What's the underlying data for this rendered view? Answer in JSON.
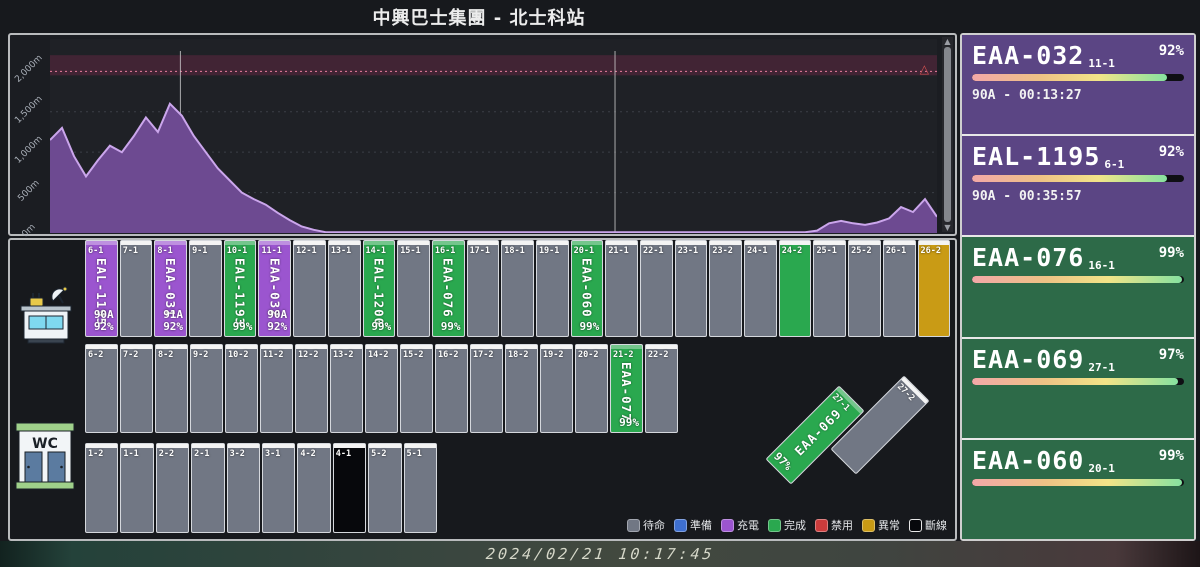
{
  "title": "中興巴士集團 - 北士科站",
  "timestamp": "2024/02/21 10:17:45",
  "chart_data": {
    "type": "area",
    "title": "",
    "xlabel": "",
    "ylabel": "distance (m)",
    "ytick_labels": [
      "2,000m",
      "1,500m",
      "1,000m",
      "500m",
      "0m"
    ],
    "yticks": [
      2000,
      1500,
      1000,
      500,
      0
    ],
    "ylim": [
      0,
      2400
    ],
    "grid": "dashed horizontal",
    "threshold_value": 2000,
    "threshold_band": [
      1950,
      2200
    ],
    "vertical_marker_fractions": [
      0.147,
      0.637
    ],
    "area_color": "#6d4a91",
    "line_color": "#cba6ec",
    "band_color": "#412434",
    "threshold_color": "#e87d9d",
    "series": [
      {
        "name": "distance",
        "values": [
          1150,
          1300,
          950,
          700,
          900,
          1080,
          1000,
          1200,
          1430,
          1250,
          1600,
          1450,
          1200,
          1000,
          800,
          650,
          500,
          420,
          350,
          250,
          160,
          80,
          40,
          10,
          10,
          10,
          10,
          10,
          10,
          10,
          10,
          10,
          10,
          10,
          10,
          10,
          10,
          10,
          10,
          10,
          10,
          10,
          10,
          10,
          10,
          10,
          10,
          10,
          10,
          10,
          10,
          10,
          10,
          10,
          10,
          10,
          10,
          10,
          10,
          10,
          10,
          10,
          10,
          10,
          30,
          120,
          150,
          120,
          100,
          130,
          180,
          320,
          260,
          420,
          200
        ]
      }
    ]
  },
  "status_colors": {
    "idle": "#717784",
    "ready": "#3e6fd0",
    "charging": "#9b55cf",
    "done": "#2aa84f",
    "disabled": "#cc3c3c",
    "abnormal": "#c99b15",
    "offline": "#07080c"
  },
  "card_colors": {
    "charging": "#5b4584",
    "done": "#2d6a48"
  },
  "legend": [
    {
      "label": "待命",
      "status": "idle"
    },
    {
      "label": "準備",
      "status": "ready"
    },
    {
      "label": "充電",
      "status": "charging"
    },
    {
      "label": "完成",
      "status": "done"
    },
    {
      "label": "禁用",
      "status": "disabled"
    },
    {
      "label": "異常",
      "status": "abnormal"
    },
    {
      "label": "斷線",
      "status": "offline"
    }
  ],
  "parking": {
    "row1": [
      {
        "id": "6-1",
        "status": "charging",
        "vehicle": "EAL-1195",
        "amp": "90A",
        "pct": "92%"
      },
      {
        "id": "7-1",
        "status": "idle"
      },
      {
        "id": "8-1",
        "status": "charging",
        "vehicle": "EAA-031",
        "amp": "91A",
        "pct": "92%"
      },
      {
        "id": "9-1",
        "status": "idle"
      },
      {
        "id": "10-1",
        "status": "done",
        "vehicle": "EAL-1193",
        "pct": "99%"
      },
      {
        "id": "11-1",
        "status": "charging",
        "vehicle": "EAA-032",
        "amp": "90A",
        "pct": "92%"
      },
      {
        "id": "12-1",
        "status": "idle"
      },
      {
        "id": "13-1",
        "status": "idle"
      },
      {
        "id": "14-1",
        "status": "done",
        "vehicle": "EAL-1200",
        "pct": "99%"
      },
      {
        "id": "15-1",
        "status": "idle"
      },
      {
        "id": "16-1",
        "status": "done",
        "vehicle": "EAA-076",
        "pct": "99%"
      },
      {
        "id": "17-1",
        "status": "idle"
      },
      {
        "id": "18-1",
        "status": "idle"
      },
      {
        "id": "19-1",
        "status": "idle"
      },
      {
        "id": "20-1",
        "status": "done",
        "vehicle": "EAA-060",
        "pct": "99%"
      },
      {
        "id": "21-1",
        "status": "idle"
      },
      {
        "id": "22-1",
        "status": "idle"
      },
      {
        "id": "23-1",
        "status": "idle"
      },
      {
        "id": "23-2",
        "status": "idle"
      },
      {
        "id": "24-1",
        "status": "idle"
      },
      {
        "id": "24-2",
        "status": "done"
      },
      {
        "id": "25-1",
        "status": "idle"
      },
      {
        "id": "25-2",
        "status": "idle"
      },
      {
        "id": "26-1",
        "status": "idle"
      },
      {
        "id": "26-2",
        "status": "abnormal"
      }
    ],
    "row2": [
      {
        "id": "6-2",
        "status": "idle"
      },
      {
        "id": "7-2",
        "status": "idle"
      },
      {
        "id": "8-2",
        "status": "idle"
      },
      {
        "id": "9-2",
        "status": "idle"
      },
      {
        "id": "10-2",
        "status": "idle"
      },
      {
        "id": "11-2",
        "status": "idle"
      },
      {
        "id": "12-2",
        "status": "idle"
      },
      {
        "id": "13-2",
        "status": "idle"
      },
      {
        "id": "14-2",
        "status": "idle"
      },
      {
        "id": "15-2",
        "status": "idle"
      },
      {
        "id": "16-2",
        "status": "idle"
      },
      {
        "id": "17-2",
        "status": "idle"
      },
      {
        "id": "18-2",
        "status": "idle"
      },
      {
        "id": "19-2",
        "status": "idle"
      },
      {
        "id": "20-2",
        "status": "idle"
      },
      {
        "id": "21-2",
        "status": "done",
        "vehicle": "EAA-077",
        "pct": "99%"
      },
      {
        "id": "22-2",
        "status": "idle"
      }
    ],
    "row3": [
      {
        "id": "1-2",
        "status": "idle"
      },
      {
        "id": "1-1",
        "status": "idle"
      },
      {
        "id": "2-2",
        "status": "idle"
      },
      {
        "id": "2-1",
        "status": "idle"
      },
      {
        "id": "3-2",
        "status": "idle"
      },
      {
        "id": "3-1",
        "status": "idle"
      },
      {
        "id": "4-2",
        "status": "idle"
      },
      {
        "id": "4-1",
        "status": "offline"
      },
      {
        "id": "5-2",
        "status": "idle"
      },
      {
        "id": "5-1",
        "status": "idle"
      }
    ],
    "diagonal": [
      {
        "id": "27-1",
        "status": "done",
        "vehicle": "EAA-069",
        "pct": "97%"
      },
      {
        "id": "27-2",
        "status": "idle"
      }
    ]
  },
  "cards": [
    {
      "vehicle": "EAA-032",
      "slot": "11-1",
      "pct": 92,
      "pct_label": "92%",
      "detail": "90A - 00:13:27",
      "status": "charging"
    },
    {
      "vehicle": "EAL-1195",
      "slot": "6-1",
      "pct": 92,
      "pct_label": "92%",
      "detail": "90A - 00:35:57",
      "status": "charging"
    },
    {
      "vehicle": "EAA-076",
      "slot": "16-1",
      "pct": 99,
      "pct_label": "99%",
      "detail": "",
      "status": "done"
    },
    {
      "vehicle": "EAA-069",
      "slot": "27-1",
      "pct": 97,
      "pct_label": "97%",
      "detail": "",
      "status": "done"
    },
    {
      "vehicle": "EAA-060",
      "slot": "20-1",
      "pct": 99,
      "pct_label": "99%",
      "detail": "",
      "status": "done"
    }
  ],
  "facilities": {
    "wc_label": "WC"
  }
}
